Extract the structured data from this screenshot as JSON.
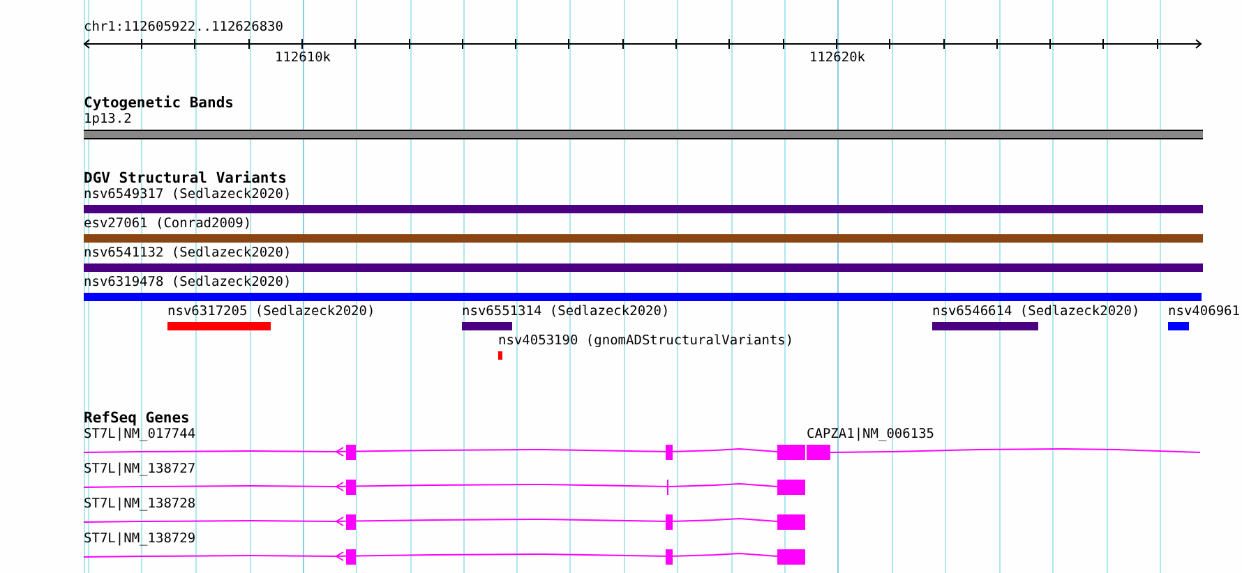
{
  "ruler": {
    "region": "chr1:112605922..112626830",
    "ticks": [
      {
        "label": "112610k"
      },
      {
        "label": "112620k"
      }
    ]
  },
  "tracks": [
    {
      "kind": "cytoband",
      "title": "Cytogenetic Bands",
      "lanes": [
        [
          {
            "label": "1p13.2"
          }
        ]
      ]
    },
    {
      "kind": "variants",
      "title": "DGV Structural Variants",
      "lanes": [
        [
          {
            "label": "nsv6549317 (Sedlazeck2020)",
            "color": "#4b0082"
          }
        ],
        [
          {
            "label": "esv27061 (Conrad2009)",
            "color": "#8b4513"
          }
        ],
        [
          {
            "label": "nsv6541132 (Sedlazeck2020)",
            "color": "#4b0082"
          }
        ],
        [
          {
            "label": "nsv6319478 (Sedlazeck2020)",
            "color": "#0000ff"
          }
        ],
        [
          {
            "label": "nsv6317205 (Sedlazeck2020)",
            "color": "#ff0000"
          },
          {
            "label": "nsv6551314 (Sedlazeck2020)",
            "color": "#4b0082"
          },
          {
            "label": "nsv6546614 (Sedlazeck2020)",
            "color": "#4b0082"
          },
          {
            "label": "nsv406961",
            "color": "#0000ff"
          }
        ],
        [
          {
            "label": "nsv4053190 (gnomADStructuralVariants)",
            "color": "#ff0000"
          }
        ]
      ]
    },
    {
      "kind": "genes",
      "title": "RefSeq Genes",
      "lanes": [
        [
          {
            "label": "ST7L|NM_017744"
          },
          {
            "label": "CAPZA1|NM_006135"
          }
        ],
        [
          {
            "label": "ST7L|NM_138727"
          }
        ],
        [
          {
            "label": "ST7L|NM_138728"
          }
        ],
        [
          {
            "label": "ST7L|NM_138729"
          }
        ]
      ]
    }
  ]
}
